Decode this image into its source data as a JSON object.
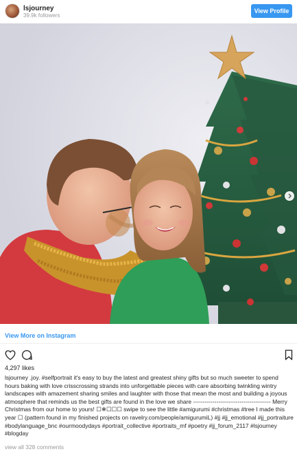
{
  "header": {
    "username": "lsjourney",
    "followers": "39.9k followers",
    "view_profile_label": "View Profile"
  },
  "photo": {
    "description_icon": "photo",
    "next_icon": "chevron-right-icon"
  },
  "footer": {
    "view_more_label": "View More on Instagram",
    "likes": "4,297 likes",
    "caption_user": "lsjourney",
    "caption_text": ".joy. #selfportrait it's easy to buy the latest and greatest shiny gifts but so much sweeter to spend hours baking with love crisscrossing strands into unforgettable pieces with care absorbing twinkling wintry landscapes with amazement sharing smiles and laughter with those that mean the most and building a joyous atmosphere that reminds us the best gifts are found in the love we share ---------------------------------------- Merry Christmas from our home to yours! ☐❄☐☐☐ swipe to see the little #amigurumi #christmas #tree I made this year ☐ (pattern found in my finished projects on ravelry.com/people/amigurumiL) #jj #jj_emotional #jj_portraiture #bodylanguage_bnc #ourmoodydays #portrait_collective #portraits_mf #poetry #jj_forum_2117 #lsjourney #blogday",
    "comments_link": "view all 328 comments"
  },
  "colors": {
    "accent": "#3897f0",
    "muted": "#999999",
    "text": "#262626"
  }
}
